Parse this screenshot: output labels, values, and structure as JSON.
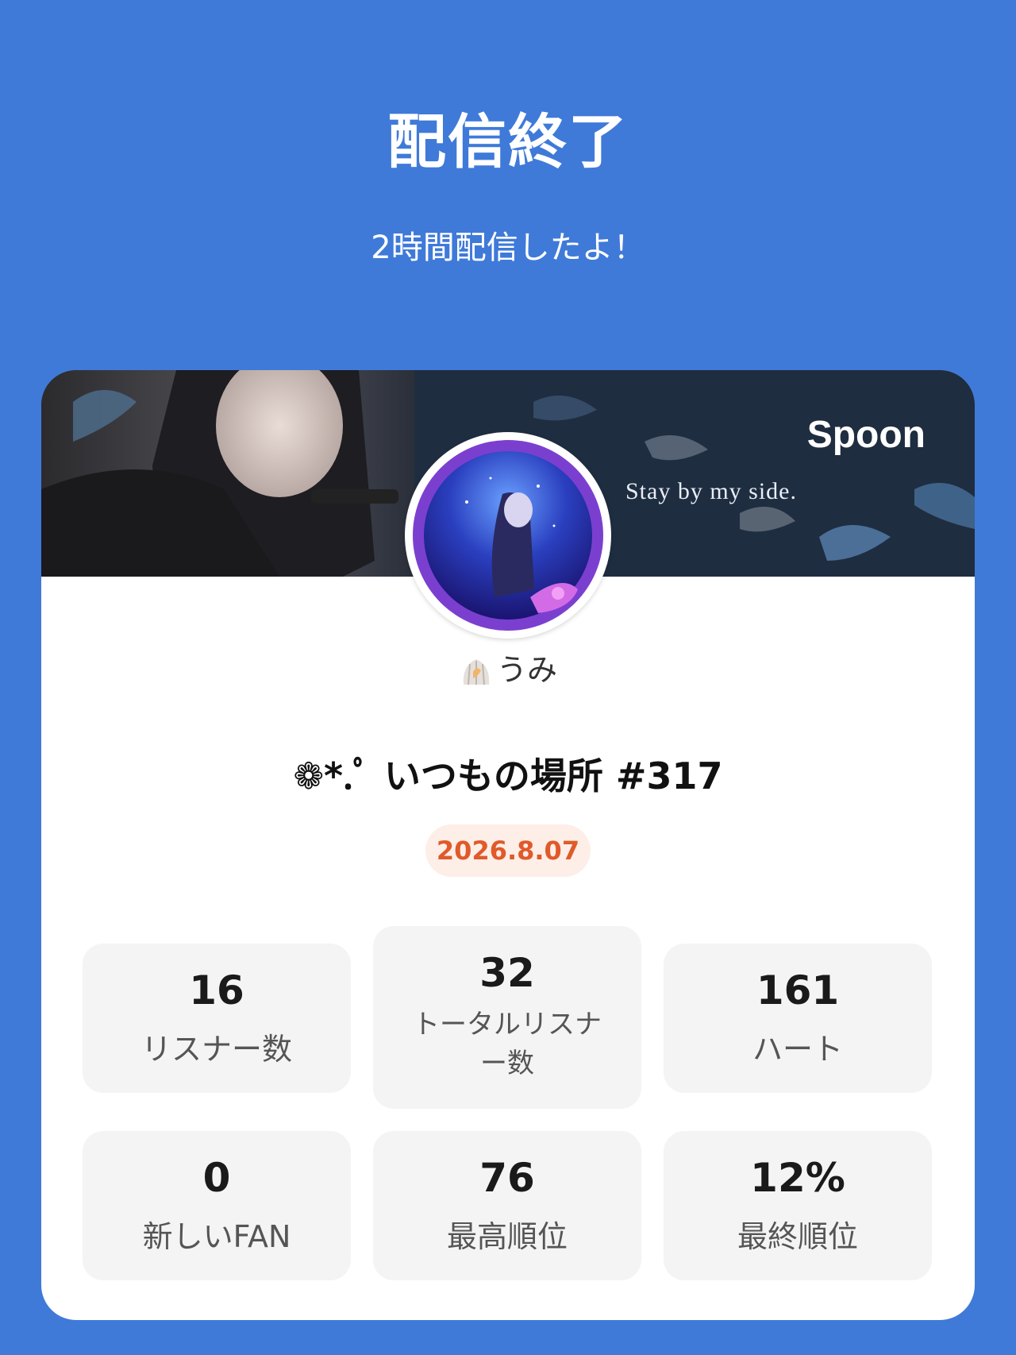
{
  "header": {
    "title": "配信終了",
    "subtitle": "2時間配信したよ！"
  },
  "banner": {
    "brand": "Spoon",
    "tagline": "Stay by my side."
  },
  "profile": {
    "username": "うみ"
  },
  "live": {
    "title": "❁*.ﾟ いつもの場所 #317",
    "date": "2026.8.07"
  },
  "stats": [
    {
      "value": "16",
      "label": "リスナー数"
    },
    {
      "value": "32",
      "label": "トータルリスナー数"
    },
    {
      "value": "161",
      "label": "ハート"
    },
    {
      "value": "0",
      "label": "新しいFAN"
    },
    {
      "value": "76",
      "label": "最高順位"
    },
    {
      "value": "12%",
      "label": "最終順位"
    }
  ],
  "colors": {
    "background": "#3f7ad9",
    "card": "#ffffff",
    "date_badge_bg": "#fdeee8",
    "date_badge_text": "#e05a2a",
    "stat_tile": "#f4f4f4"
  }
}
